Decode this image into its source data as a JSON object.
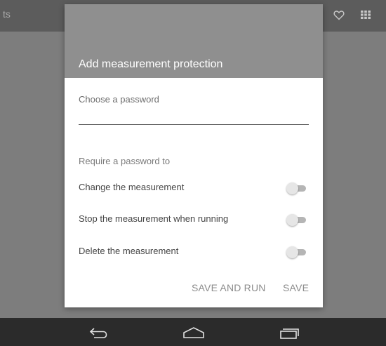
{
  "background_app": {
    "toolbar_title_fragment": "ts",
    "icons": [
      "heart-icon",
      "grid-icon"
    ]
  },
  "dialog": {
    "title": "Add measurement protection",
    "password": {
      "label": "Choose a password",
      "value": "",
      "placeholder": ""
    },
    "require_label": "Require a password to",
    "options": [
      {
        "label": "Change the measurement",
        "checked": false
      },
      {
        "label": "Stop the measurement when running",
        "checked": false
      },
      {
        "label": "Delete the measurement",
        "checked": false
      }
    ],
    "actions": {
      "save_and_run": "SAVE AND RUN",
      "save": "SAVE"
    }
  },
  "navbar": {
    "icons": [
      "back-icon",
      "home-icon",
      "recents-icon"
    ]
  },
  "colors": {
    "dialog_header": "#8f8f8f",
    "scrim": "#7d7d7d",
    "navbar": "#2b2b2b",
    "action_text": "#8c8c8c"
  }
}
